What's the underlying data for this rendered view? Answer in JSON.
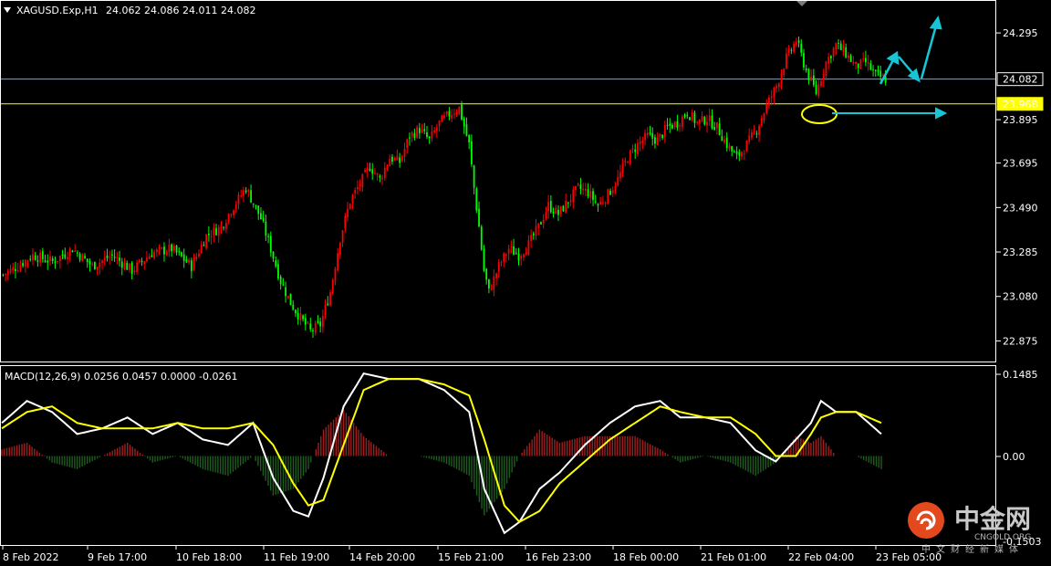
{
  "header": {
    "symbol_icon": "triangle-down-icon",
    "symbol": "XAGUSD.Exp,H1",
    "ohlc": "24.062 24.086 24.011 24.082"
  },
  "macd": {
    "label": "MACD(12,26,9) 0.0256 0.0457 0.0000 -0.0261",
    "axis_top": "0.1485",
    "axis_zero": "0.00",
    "axis_bottom": "-0.1503"
  },
  "colors": {
    "background": "#000000",
    "bull": "#ff0000",
    "bear": "#00ff00",
    "level_line": "#ffff00",
    "bid_line": "#8aa0b4",
    "arrow": "#17c5d6",
    "macd_line": "#ffffff",
    "signal_line": "#ffff00",
    "hist_pos": "#a11e1e",
    "hist_neg": "#1f5c1f"
  },
  "watermark": {
    "text_cn": "中金网",
    "text_en": "CNGOLD.ORG",
    "text_sub": "中文财经新媒体",
    "logo_icon": "cngold-logo-icon"
  },
  "chart_data": {
    "type": "candlestick",
    "symbol": "XAGUSD.Exp",
    "timeframe": "H1",
    "ylim": [
      22.78,
      24.43
    ],
    "y_ticks": [
      "24.295",
      "24.082",
      "23.968",
      "23.895",
      "23.695",
      "23.490",
      "23.285",
      "23.080",
      "22.875"
    ],
    "y_tick_values": [
      24.295,
      24.082,
      23.968,
      23.895,
      23.695,
      23.49,
      23.285,
      23.08,
      22.875
    ],
    "x_ticks": [
      "8 Feb 2022",
      "9 Feb 17:00",
      "10 Feb 18:00",
      "11 Feb 19:00",
      "14 Feb 20:00",
      "15 Feb 21:00",
      "16 Feb 23:00",
      "18 Feb 00:00",
      "21 Feb 01:00",
      "22 Feb 04:00",
      "23 Feb 05:00"
    ],
    "current_price": 24.082,
    "support_level": 23.968,
    "close_path": [
      [
        0,
        23.18
      ],
      [
        6,
        23.22
      ],
      [
        12,
        23.27
      ],
      [
        20,
        23.24
      ],
      [
        28,
        23.3
      ],
      [
        36,
        23.22
      ],
      [
        44,
        23.27
      ],
      [
        52,
        23.2
      ],
      [
        60,
        23.28
      ],
      [
        68,
        23.3
      ],
      [
        76,
        23.22
      ],
      [
        82,
        23.36
      ],
      [
        88,
        23.4
      ],
      [
        92,
        23.48
      ],
      [
        98,
        23.58
      ],
      [
        104,
        23.44
      ],
      [
        108,
        23.3
      ],
      [
        112,
        23.15
      ],
      [
        116,
        23.05
      ],
      [
        120,
        22.98
      ],
      [
        124,
        22.92
      ],
      [
        128,
        22.95
      ],
      [
        132,
        23.1
      ],
      [
        136,
        23.35
      ],
      [
        140,
        23.52
      ],
      [
        144,
        23.6
      ],
      [
        148,
        23.68
      ],
      [
        152,
        23.62
      ],
      [
        156,
        23.72
      ],
      [
        160,
        23.7
      ],
      [
        164,
        23.82
      ],
      [
        168,
        23.85
      ],
      [
        172,
        23.8
      ],
      [
        176,
        23.88
      ],
      [
        180,
        23.92
      ],
      [
        184,
        23.95
      ],
      [
        188,
        23.78
      ],
      [
        190,
        23.58
      ],
      [
        192,
        23.4
      ],
      [
        194,
        23.2
      ],
      [
        196,
        23.1
      ],
      [
        200,
        23.22
      ],
      [
        204,
        23.3
      ],
      [
        208,
        23.27
      ],
      [
        212,
        23.32
      ],
      [
        216,
        23.4
      ],
      [
        220,
        23.5
      ],
      [
        224,
        23.46
      ],
      [
        228,
        23.52
      ],
      [
        232,
        23.58
      ],
      [
        236,
        23.56
      ],
      [
        240,
        23.5
      ],
      [
        244,
        23.55
      ],
      [
        248,
        23.62
      ],
      [
        252,
        23.72
      ],
      [
        256,
        23.78
      ],
      [
        260,
        23.82
      ],
      [
        264,
        23.8
      ],
      [
        268,
        23.86
      ],
      [
        272,
        23.88
      ],
      [
        276,
        23.93
      ],
      [
        280,
        23.88
      ],
      [
        284,
        23.9
      ],
      [
        288,
        23.86
      ],
      [
        292,
        23.78
      ],
      [
        296,
        23.72
      ],
      [
        300,
        23.78
      ],
      [
        304,
        23.85
      ],
      [
        308,
        23.96
      ],
      [
        312,
        24.05
      ],
      [
        316,
        24.18
      ],
      [
        320,
        24.26
      ],
      [
        324,
        24.12
      ],
      [
        328,
        24.02
      ],
      [
        332,
        24.16
      ],
      [
        336,
        24.24
      ],
      [
        340,
        24.2
      ],
      [
        344,
        24.14
      ],
      [
        348,
        24.16
      ],
      [
        352,
        24.1
      ],
      [
        356,
        24.082
      ]
    ],
    "macd": {
      "ylim": [
        -0.1503,
        0.1485
      ],
      "macd_path": [
        [
          0,
          0.06
        ],
        [
          10,
          0.1
        ],
        [
          20,
          0.08
        ],
        [
          30,
          0.04
        ],
        [
          40,
          0.05
        ],
        [
          50,
          0.07
        ],
        [
          60,
          0.04
        ],
        [
          70,
          0.06
        ],
        [
          80,
          0.03
        ],
        [
          90,
          0.02
        ],
        [
          100,
          0.06
        ],
        [
          108,
          -0.04
        ],
        [
          116,
          -0.1
        ],
        [
          122,
          -0.11
        ],
        [
          128,
          -0.04
        ],
        [
          136,
          0.09
        ],
        [
          144,
          0.15
        ],
        [
          154,
          0.14
        ],
        [
          166,
          0.14
        ],
        [
          176,
          0.12
        ],
        [
          186,
          0.08
        ],
        [
          192,
          -0.06
        ],
        [
          200,
          -0.14
        ],
        [
          206,
          -0.12
        ],
        [
          214,
          -0.06
        ],
        [
          222,
          -0.03
        ],
        [
          232,
          0.02
        ],
        [
          242,
          0.06
        ],
        [
          252,
          0.09
        ],
        [
          262,
          0.1
        ],
        [
          270,
          0.07
        ],
        [
          280,
          0.07
        ],
        [
          290,
          0.06
        ],
        [
          300,
          0.01
        ],
        [
          308,
          -0.01
        ],
        [
          316,
          0.03
        ],
        [
          322,
          0.06
        ],
        [
          326,
          0.1
        ],
        [
          332,
          0.08
        ],
        [
          340,
          0.08
        ],
        [
          350,
          0.04
        ]
      ],
      "signal_path": [
        [
          0,
          0.05
        ],
        [
          10,
          0.08
        ],
        [
          20,
          0.09
        ],
        [
          30,
          0.06
        ],
        [
          40,
          0.05
        ],
        [
          50,
          0.05
        ],
        [
          60,
          0.05
        ],
        [
          70,
          0.06
        ],
        [
          80,
          0.05
        ],
        [
          90,
          0.05
        ],
        [
          100,
          0.06
        ],
        [
          108,
          0.02
        ],
        [
          116,
          -0.05
        ],
        [
          122,
          -0.09
        ],
        [
          128,
          -0.08
        ],
        [
          136,
          0.02
        ],
        [
          144,
          0.12
        ],
        [
          154,
          0.14
        ],
        [
          166,
          0.14
        ],
        [
          176,
          0.13
        ],
        [
          186,
          0.11
        ],
        [
          192,
          0.03
        ],
        [
          200,
          -0.09
        ],
        [
          206,
          -0.12
        ],
        [
          214,
          -0.1
        ],
        [
          222,
          -0.05
        ],
        [
          232,
          -0.01
        ],
        [
          242,
          0.03
        ],
        [
          252,
          0.06
        ],
        [
          262,
          0.09
        ],
        [
          270,
          0.08
        ],
        [
          280,
          0.07
        ],
        [
          290,
          0.07
        ],
        [
          300,
          0.04
        ],
        [
          308,
          0.0
        ],
        [
          316,
          0.0
        ],
        [
          322,
          0.04
        ],
        [
          326,
          0.07
        ],
        [
          332,
          0.08
        ],
        [
          340,
          0.08
        ],
        [
          350,
          0.06
        ]
      ]
    }
  }
}
